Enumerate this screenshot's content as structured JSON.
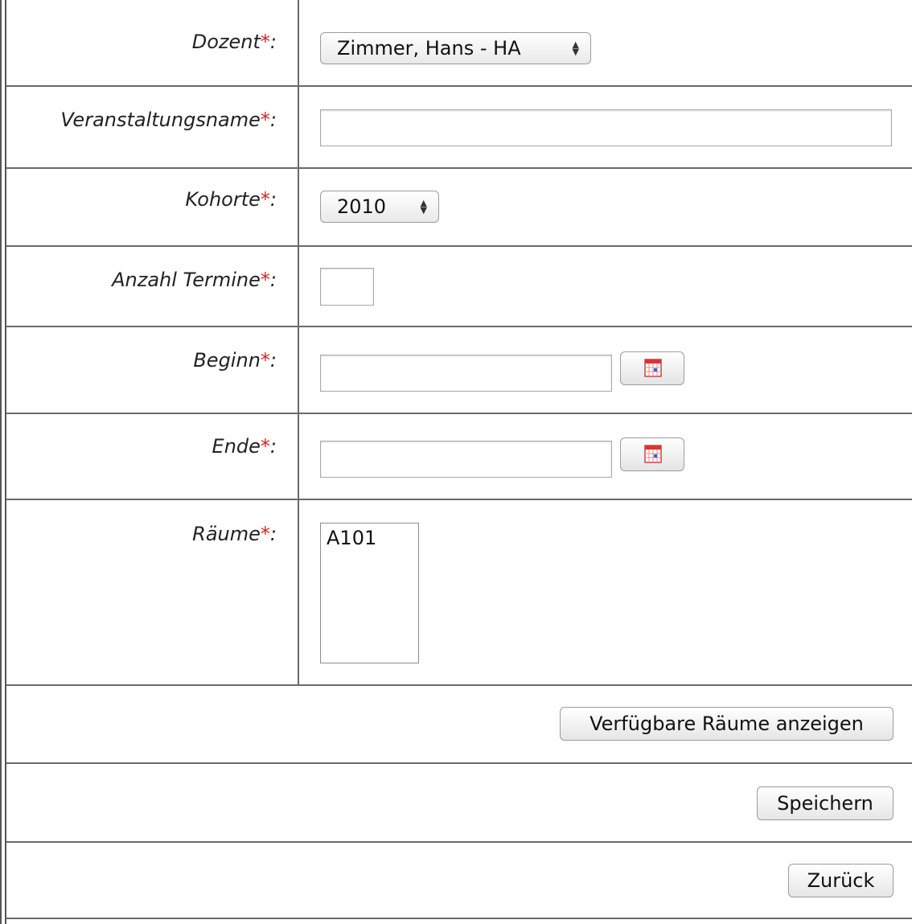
{
  "form": {
    "required_marker": "*",
    "fields": {
      "dozent": {
        "label": "Dozent",
        "selected": "Zimmer, Hans - HA"
      },
      "veranstaltungsname": {
        "label": "Veranstaltungsname",
        "value": ""
      },
      "kohorte": {
        "label": "Kohorte",
        "selected": "2010"
      },
      "anzahl_termine": {
        "label": "Anzahl Termine",
        "value": ""
      },
      "beginn": {
        "label": "Beginn",
        "value": ""
      },
      "ende": {
        "label": "Ende",
        "value": ""
      },
      "raeume": {
        "label": "Räume",
        "options": [
          "A101"
        ]
      }
    },
    "buttons": {
      "show_rooms": "Verfügbare Räume anzeigen",
      "save": "Speichern",
      "back": "Zurück"
    },
    "colors": {
      "required_star": "#dd2222",
      "border": "#6a6a6a"
    }
  },
  "icons": {
    "calendar": "calendar-icon",
    "select_arrows": "updown-arrows-icon"
  }
}
